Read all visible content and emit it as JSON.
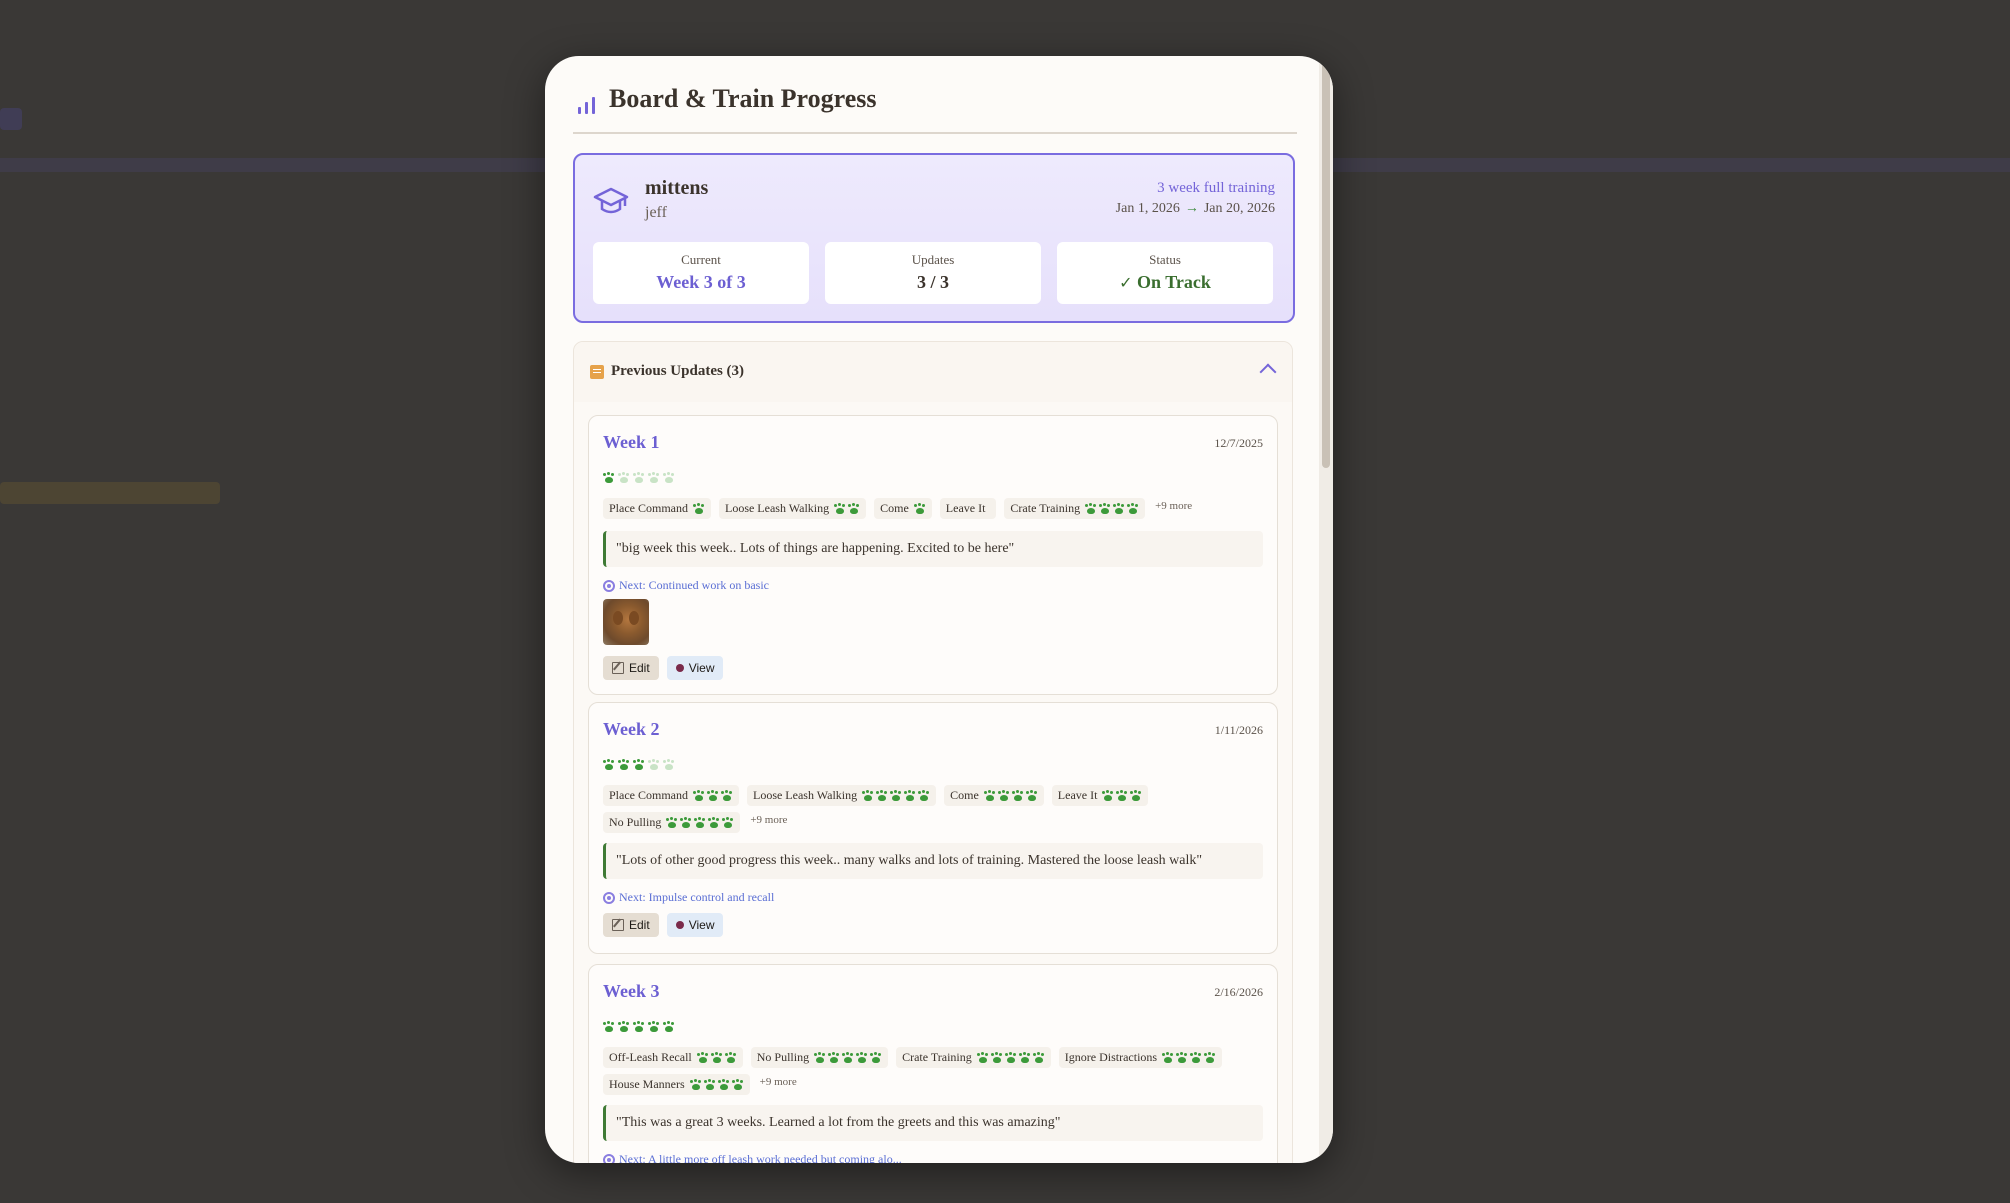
{
  "header": {
    "title": "Board & Train Progress"
  },
  "summary": {
    "dog_name": "mittens",
    "owner_name": "jeff",
    "program": "3 week full training",
    "start_date": "Jan 1, 2026",
    "end_date": "Jan 20, 2026",
    "stats": {
      "current_label": "Current",
      "current_value": "Week 3 of 3",
      "updates_label": "Updates",
      "updates_value": "3 / 3",
      "status_label": "Status",
      "status_value": "On Track"
    }
  },
  "updates": {
    "title": "Previous Updates (3)",
    "edit_label": "Edit",
    "view_label": "View",
    "weeks": [
      {
        "title": "Week 1",
        "date": "12/7/2025",
        "rating": 1,
        "skills": [
          {
            "name": "Place Command",
            "paws": 1
          },
          {
            "name": "Loose Leash Walking",
            "paws": 2
          },
          {
            "name": "Come",
            "paws": 1
          },
          {
            "name": "Leave It",
            "paws": 0
          },
          {
            "name": "Crate Training",
            "paws": 4
          }
        ],
        "more": "+9 more",
        "note": "\"big week this week.. Lots of things are happening. Excited to be here\"",
        "next": "Next: Continued work on basic"
      },
      {
        "title": "Week 2",
        "date": "1/11/2026",
        "rating": 3,
        "skills": [
          {
            "name": "Place Command",
            "paws": 3
          },
          {
            "name": "Loose Leash Walking",
            "paws": 5
          },
          {
            "name": "Come",
            "paws": 4
          },
          {
            "name": "Leave It",
            "paws": 3
          },
          {
            "name": "No Pulling",
            "paws": 5
          }
        ],
        "more": "+9 more",
        "note": "\"Lots of other good progress this week.. many walks and lots of training. Mastered the loose leash walk\"",
        "next": "Next: Impulse control and recall"
      },
      {
        "title": "Week 3",
        "date": "2/16/2026",
        "rating": 5,
        "skills": [
          {
            "name": "Off-Leash Recall",
            "paws": 3
          },
          {
            "name": "No Pulling",
            "paws": 5
          },
          {
            "name": "Crate Training",
            "paws": 5
          },
          {
            "name": "Ignore Distractions",
            "paws": 4
          },
          {
            "name": "House Manners",
            "paws": 4
          }
        ],
        "more": "+9 more",
        "note": "\"This was a great 3 weeks. Learned a lot from the greets and this was amazing\"",
        "next": "Next: A little more off leash work needed but coming alo..."
      }
    ]
  }
}
